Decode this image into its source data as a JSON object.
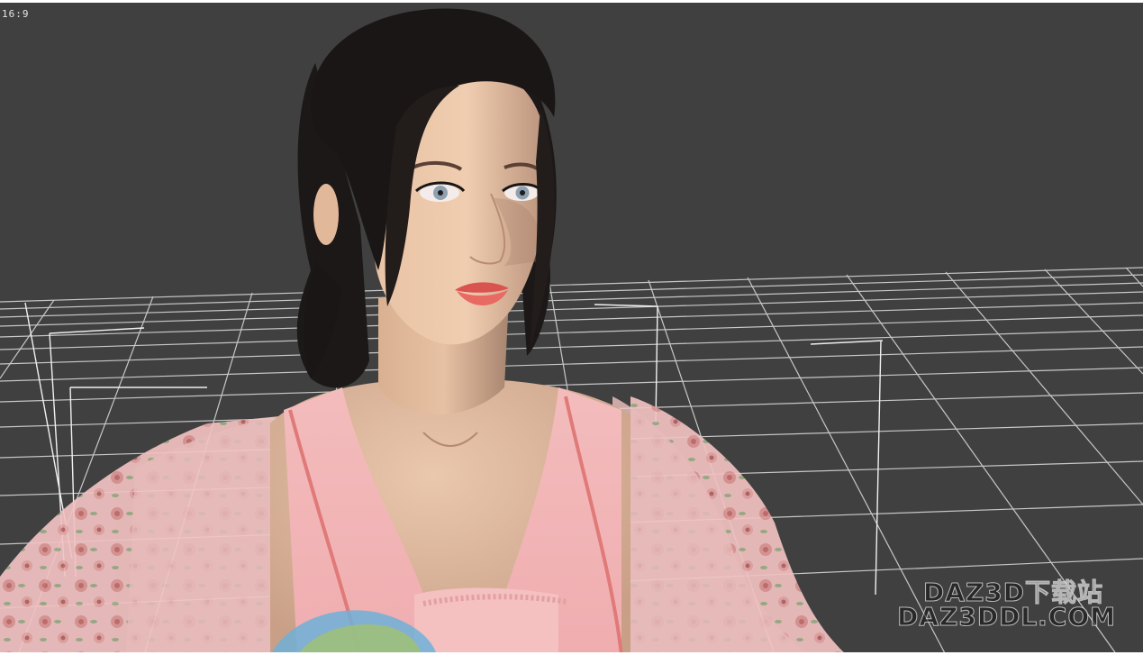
{
  "viewport": {
    "aspect_ratio_label": "16:9",
    "background_color": "#404040",
    "grid_color": "#d8d8d8"
  },
  "figure": {
    "hair_color": "#1a1615",
    "skin_color": "#e9c3a6",
    "lip_color": "#e0605c",
    "eye_color": "#8fa0b0",
    "dress_color": "#f2b4b6",
    "dress_trim_color": "#e8807e",
    "floral_color": "#d98a8a"
  },
  "watermark": {
    "line1": "DAZ3D下载站",
    "line2": "DAZ3DDL.COM"
  }
}
